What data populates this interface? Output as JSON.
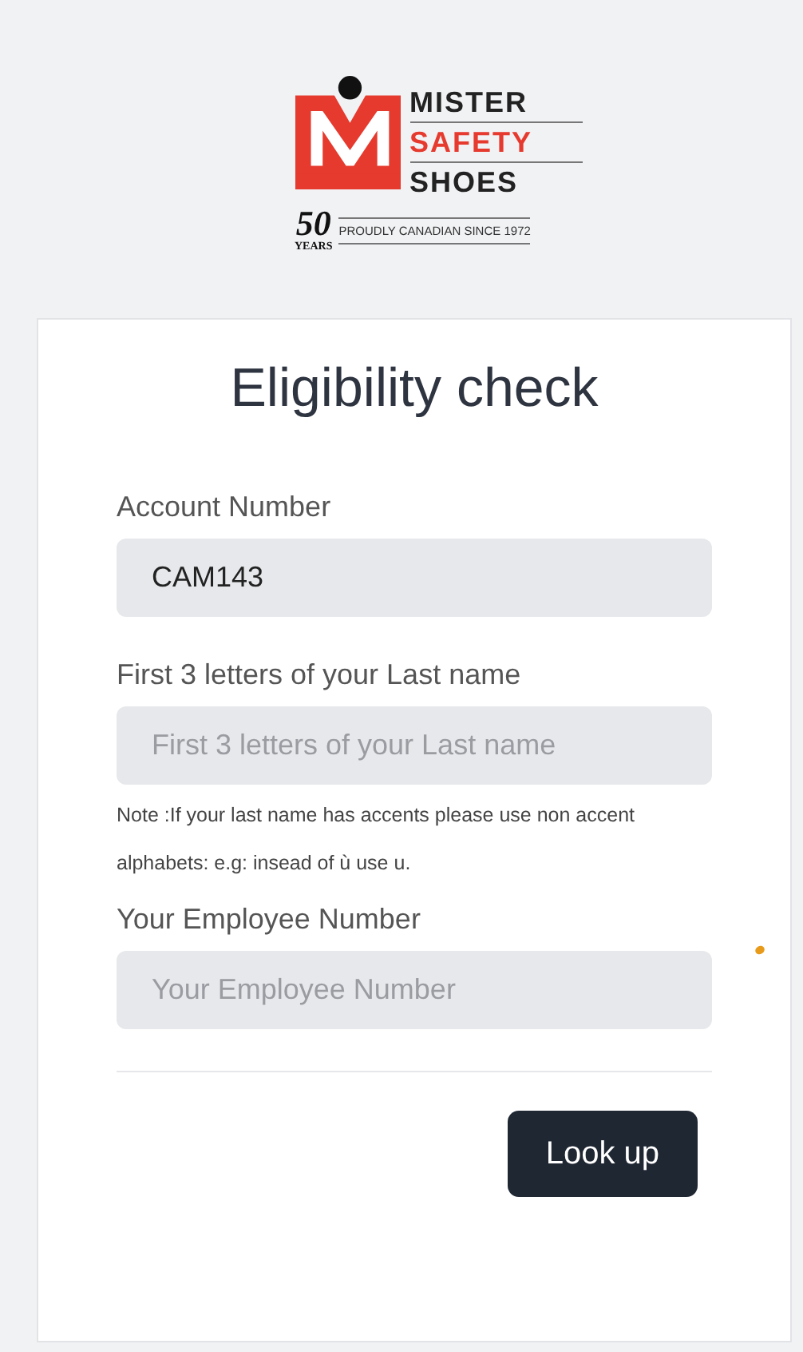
{
  "logo": {
    "words": [
      "MISTER",
      "SAFETY",
      "SHOES"
    ],
    "anniversary": "50",
    "anniversary_unit": "YEARS",
    "tagline": "PROUDLY CANADIAN SINCE 1972"
  },
  "title": "Eligibility check",
  "fields": [
    {
      "label": "Account Number",
      "value": "CAM143"
    },
    {
      "label": "First 3 letters of your Last name",
      "placeholder": "First 3 letters of your Last name",
      "note": "Note :If your last name has accents please use non accent alphabets: e.g: insead of ù use u."
    },
    {
      "label": "Your Employee Number",
      "placeholder": "Your Employee Number"
    }
  ],
  "button": "Look up"
}
